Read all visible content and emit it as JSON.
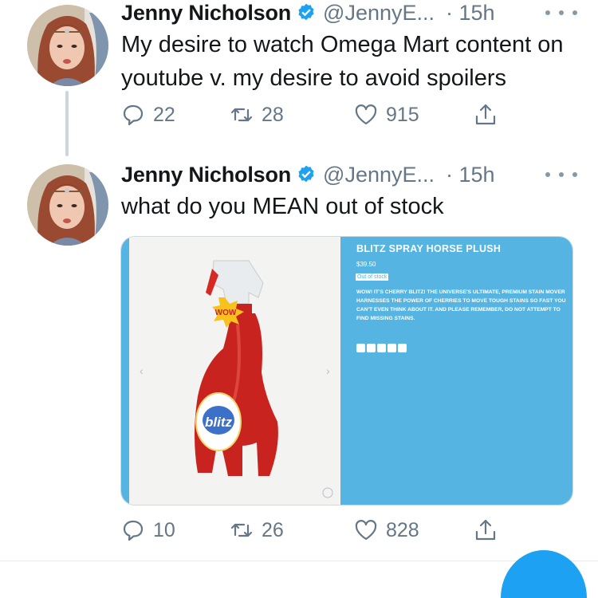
{
  "tweets": [
    {
      "name": "Jenny Nicholson",
      "handle": "@JennyE...",
      "time": "· 15h",
      "text": "My desire to watch Omega Mart content on youtube v. my desire to avoid spoilers",
      "replies": "22",
      "retweets": "28",
      "likes": "915"
    },
    {
      "name": "Jenny Nicholson",
      "handle": "@JennyE...",
      "time": "· 15h",
      "text": "what do you MEAN out of stock",
      "replies": "10",
      "retweets": "26",
      "likes": "828",
      "card": {
        "product_title": "BLITZ SPRAY HORSE PLUSH",
        "price": "$39.50",
        "stock_status": "Out of stock",
        "description": "WOW! IT'S CHERRY BLITZ! THE UNIVERSE'S ULTIMATE, PREMIUM STAIN MOVER HARNESSES THE POWER OF CHERRIES TO MOVE TOUGH STAINS SO FAST YOU CAN'T EVEN THINK ABOUT IT. AND PLEASE REMEMBER, DO NOT ATTEMPT TO FIND MISSING STAINS.",
        "badge_text": "WOW",
        "logo_text": "blitz",
        "prev_arrow": "‹",
        "next_arrow": "›"
      }
    }
  ],
  "icons": [
    "reply-icon",
    "retweet-icon",
    "like-icon",
    "share-icon",
    "verified-icon",
    "more-icon"
  ],
  "colors": {
    "text": "#14171a",
    "secondary": "#657786",
    "verified": "#1da1f2",
    "card_blue": "#55b4e2",
    "bottle_red": "#c9231f"
  }
}
